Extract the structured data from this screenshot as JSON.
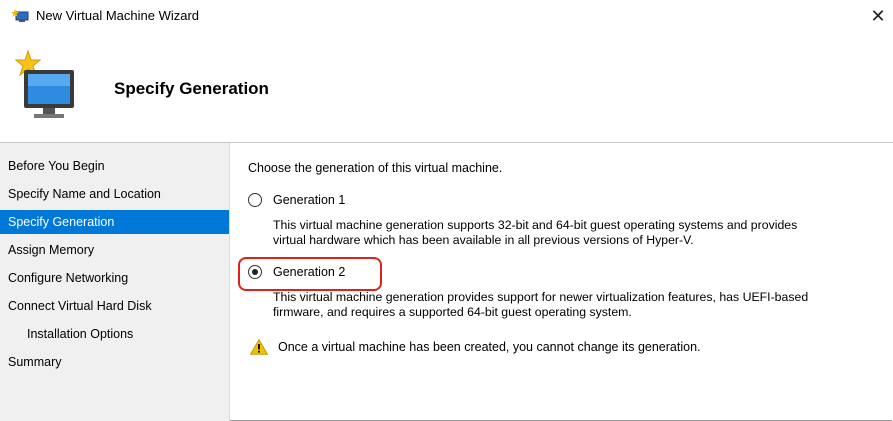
{
  "window": {
    "title": "New Virtual Machine Wizard",
    "close_glyph": "✕"
  },
  "header": {
    "title": "Specify Generation",
    "icon": "computer-star-icon"
  },
  "sidebar": {
    "items": [
      {
        "label": "Before You Begin",
        "selected": false,
        "indent": false
      },
      {
        "label": "Specify Name and Location",
        "selected": false,
        "indent": false
      },
      {
        "label": "Specify Generation",
        "selected": true,
        "indent": false
      },
      {
        "label": "Assign Memory",
        "selected": false,
        "indent": false
      },
      {
        "label": "Configure Networking",
        "selected": false,
        "indent": false
      },
      {
        "label": "Connect Virtual Hard Disk",
        "selected": false,
        "indent": false
      },
      {
        "label": "Installation Options",
        "selected": false,
        "indent": true
      },
      {
        "label": "Summary",
        "selected": false,
        "indent": false
      }
    ]
  },
  "main": {
    "intro": "Choose the generation of this virtual machine.",
    "gen1": {
      "label": "Generation 1",
      "selected": false,
      "desc_line1": "This virtual machine generation supports 32-bit and 64-bit guest operating systems and provides",
      "desc_line2": "virtual hardware which has been available in all previous versions of Hyper-V."
    },
    "gen2": {
      "label": "Generation 2",
      "selected": true,
      "desc_line1": "This virtual machine generation provides support for newer virtualization features, has UEFI-based",
      "desc_line2": "firmware, and requires a supported 64-bit guest operating system."
    },
    "warning": "Once a virtual machine has been created, you cannot change its generation."
  },
  "colors": {
    "accent": "#0078d7",
    "highlight": "#e0201a",
    "warning": "#f2c200"
  }
}
